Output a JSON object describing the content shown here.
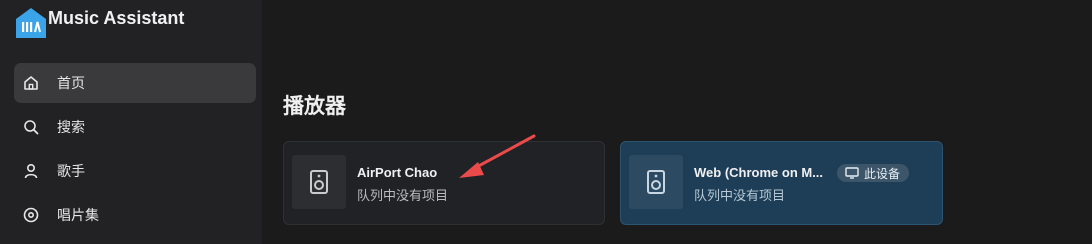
{
  "app": {
    "title": "Music Assistant",
    "logo_icon": "music-assistant-logo",
    "brand_color": "#3ba3e8"
  },
  "sidebar": {
    "items": [
      {
        "label": "首页",
        "icon": "home-icon",
        "active": true
      },
      {
        "label": "搜索",
        "icon": "search-icon",
        "active": false
      },
      {
        "label": "歌手",
        "icon": "person-icon",
        "active": false
      },
      {
        "label": "唱片集",
        "icon": "album-icon",
        "active": false
      }
    ]
  },
  "main": {
    "section_title": "播放器",
    "players": [
      {
        "name": "AirPort Chao",
        "status": "队列中没有项目",
        "icon": "speaker-icon",
        "selected": false
      },
      {
        "name": "Web (Chrome on M...",
        "status": "队列中没有项目",
        "icon": "speaker-icon",
        "selected": true,
        "badge": "此设备",
        "badge_icon": "monitor-icon"
      }
    ]
  },
  "annotation": {
    "type": "red-arrow",
    "color": "#ea4a4a"
  }
}
